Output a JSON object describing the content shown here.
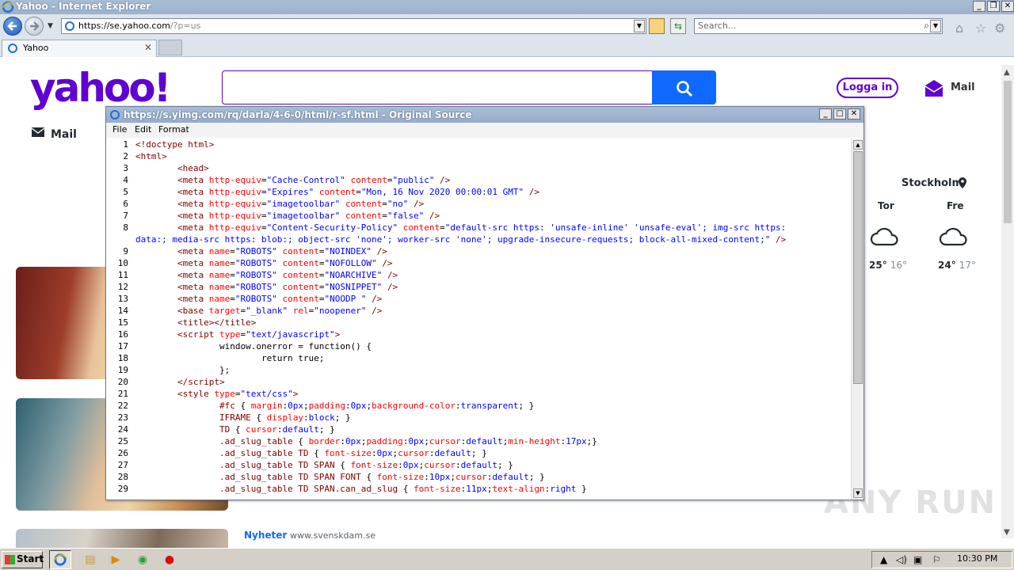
{
  "browser": {
    "window_title": "Yahoo - Internet Explorer",
    "address_host": "https://se.yahoo.com",
    "address_tail": "/?p=us",
    "search_placeholder": "Search...",
    "tab_label": "Yahoo"
  },
  "yahoo": {
    "logo": "yahoo!",
    "login_label": "Logga in",
    "mail_label": "Mail",
    "side_mail_label": "Mail",
    "news_category": "Nyheter",
    "news_source": "www.svenskdam.se",
    "brand_color": "#6001d2",
    "accent_color": "#0f69ff"
  },
  "weather": {
    "city": "Stockholm",
    "days": [
      {
        "day": "Tor",
        "high": "25°",
        "low": "16°",
        "icon": "cloud-icon"
      },
      {
        "day": "Fre",
        "high": "24°",
        "low": "17°",
        "icon": "cloud-icon"
      }
    ]
  },
  "source_viewer": {
    "title": "https://s.yimg.com/rq/darla/4-6-0/html/r-sf.html - Original Source",
    "menu": [
      "File",
      "Edit",
      "Format"
    ],
    "line_numbers": [
      "1",
      "2",
      "3",
      "4",
      "5",
      "6",
      "7",
      "8",
      "",
      "9",
      "10",
      "11",
      "12",
      "13",
      "14",
      "15",
      "16",
      "17",
      "18",
      "19",
      "20",
      "21",
      "22",
      "23",
      "24",
      "25",
      "26",
      "27",
      "28",
      "29"
    ]
  },
  "watermark": "ANY RUN",
  "taskbar": {
    "start_label": "Start",
    "clock": "10:30 PM"
  }
}
